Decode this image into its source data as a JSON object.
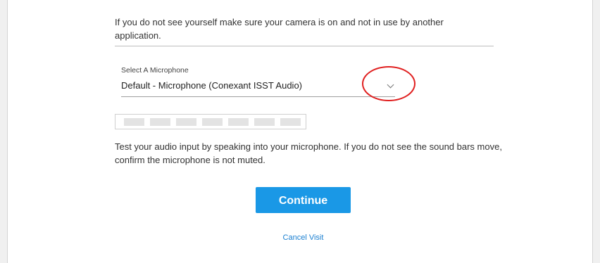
{
  "camera": {
    "note": "If you do not see yourself make sure your camera is on and not in use by another application."
  },
  "microphone": {
    "label": "Select A Microphone",
    "selected": "Default - Microphone (Conexant ISST Audio)",
    "dropdown_icon": "chevron-down-icon"
  },
  "audio_level": {
    "bar_count": 7,
    "active_bars": 0
  },
  "audio_test": {
    "note": "Test your audio input by speaking into your microphone. If you do not see the sound bars move, confirm the microphone is not muted."
  },
  "actions": {
    "continue_label": "Continue",
    "cancel_label": "Cancel Visit"
  },
  "colors": {
    "primary_button": "#1a98e6",
    "link": "#1a7fd1",
    "annotation": "#e02020"
  }
}
